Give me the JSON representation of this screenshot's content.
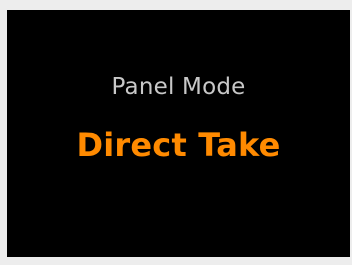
{
  "panel": {
    "caption": "Panel Mode",
    "value": "Direct Take"
  },
  "colors": {
    "background": "#000000",
    "caption": "#c8c8c8",
    "value_accent": "#ff8a00",
    "bezel": "#ededed"
  }
}
